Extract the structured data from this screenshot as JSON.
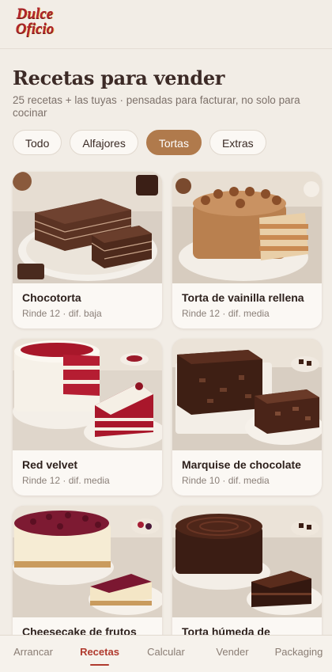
{
  "brand": {
    "logo_line1": "Dulce",
    "logo_line2": "Oficio"
  },
  "header": {
    "title": "Recetas para vender",
    "subtitle": "25 recetas + las tuyas · pensadas para facturar, no solo para cocinar"
  },
  "filters": [
    {
      "label": "Todo",
      "active": false
    },
    {
      "label": "Alfajores",
      "active": false
    },
    {
      "label": "Tortas",
      "active": true
    },
    {
      "label": "Extras",
      "active": false
    }
  ],
  "recipes": [
    {
      "title": "Chocotorta",
      "meta": "Rinde 12 · dif. baja"
    },
    {
      "title": "Torta de vainilla rellena",
      "meta": "Rinde 12 · dif. media"
    },
    {
      "title": "Red velvet",
      "meta": "Rinde 12 · dif. media"
    },
    {
      "title": "Marquise de chocolate",
      "meta": "Rinde 10 · dif. media"
    },
    {
      "title": "Cheesecake de frutos",
      "meta": ""
    },
    {
      "title": "Torta húmeda de",
      "meta": ""
    }
  ],
  "nav": [
    {
      "label": "Arrancar",
      "active": false
    },
    {
      "label": "Recetas",
      "active": true
    },
    {
      "label": "Calcular",
      "active": false
    },
    {
      "label": "Vender",
      "active": false
    },
    {
      "label": "Packaging",
      "active": false
    }
  ],
  "colors": {
    "background": "#f2ede6",
    "chip_active": "#b07a4c",
    "nav_active": "#b03a2e",
    "logo": "#b3262b"
  }
}
